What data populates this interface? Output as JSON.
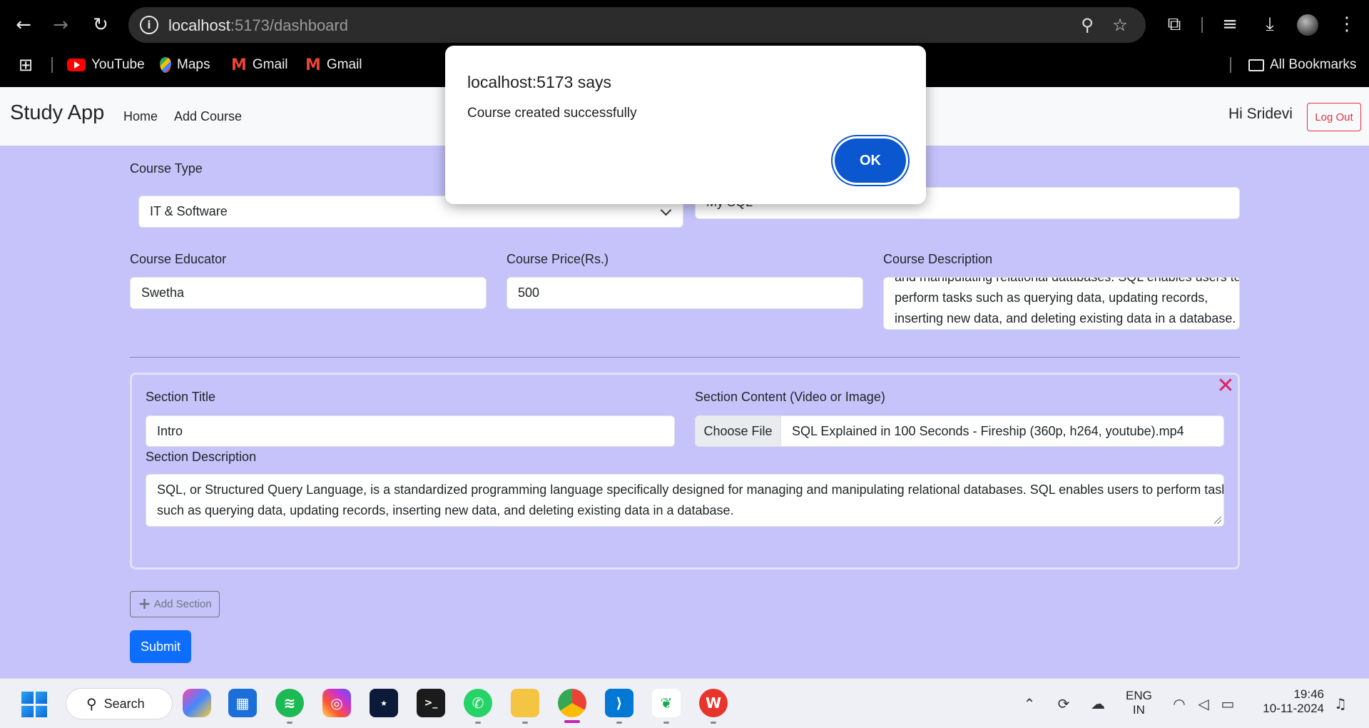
{
  "browser": {
    "url_host": "localhost",
    "url_path": ":5173/dashboard",
    "bookmarks": [
      {
        "label": "YouTube",
        "icon": "youtube-icon"
      },
      {
        "label": "Maps",
        "icon": "maps-icon"
      },
      {
        "label": "Gmail",
        "icon": "gmail-icon"
      },
      {
        "label": "Gmail",
        "icon": "gmail-icon"
      }
    ],
    "all_bookmarks_label": "All Bookmarks"
  },
  "app": {
    "brand": "Study App",
    "nav": {
      "home": "Home",
      "add_course": "Add Course"
    },
    "greeting": "Hi Sridevi",
    "logout_label": "Log Out"
  },
  "form": {
    "course_type_label": "Course Type",
    "course_type_value": "IT & Software",
    "course_title_value": "My SQL",
    "educator_label": "Course Educator",
    "educator_value": "Swetha",
    "price_label": "Course Price(Rs.)",
    "price_value": "500",
    "description_label": "Course Description",
    "description_lines": [
      "and manipulating relational databases. SQL enables users to",
      "perform tasks such as querying data, updating records,",
      "inserting new data, and deleting existing data in a database."
    ],
    "section": {
      "title_label": "Section Title",
      "title_value": "Intro",
      "content_label": "Section Content (Video or Image)",
      "choose_file_label": "Choose File",
      "file_name": "SQL Explained in 100 Seconds - Fireship (360p, h264, youtube).mp4",
      "description_label": "Section Description",
      "description_lines": [
        "SQL, or Structured Query Language, is a standardized programming language specifically designed for managing and manipulating relational databases. SQL enables users to perform tasks",
        "such as querying data, updating records, inserting new data, and deleting existing data in a database."
      ]
    },
    "add_section_label": "Add Section",
    "submit_label": "Submit"
  },
  "dialog": {
    "title": "localhost:5173 says",
    "message": "Course created successfully",
    "ok_label": "OK"
  },
  "taskbar": {
    "search_label": "Search",
    "lang_line1": "ENG",
    "lang_line2": "IN",
    "time": "19:46",
    "date": "10-11-2024"
  },
  "colors": {
    "page_bg": "#c5c3fa",
    "primary": "#0d6efd",
    "danger": "#dc3545",
    "dialog_ok": "#0b57d0"
  }
}
